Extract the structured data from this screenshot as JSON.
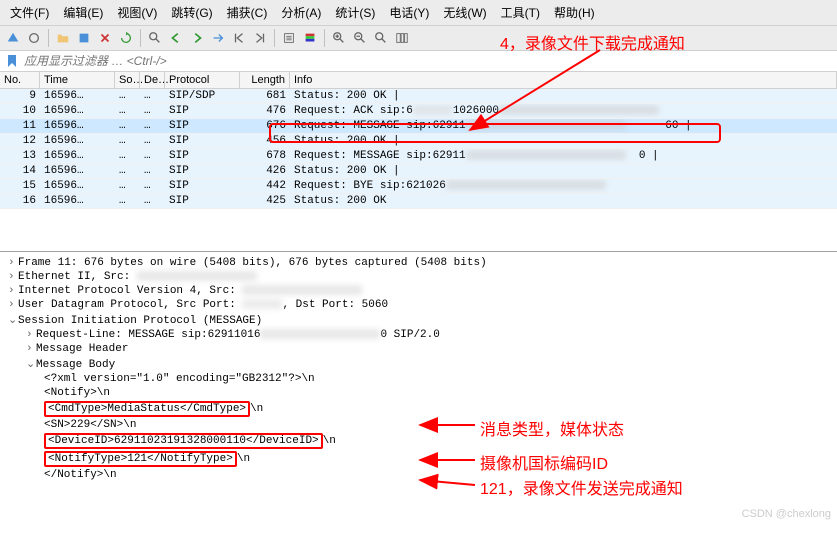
{
  "menu": {
    "file": "文件(F)",
    "edit": "编辑(E)",
    "view": "视图(V)",
    "go": "跳转(G)",
    "capture": "捕获(C)",
    "analyze": "分析(A)",
    "statistics": "统计(S)",
    "telephony": "电话(Y)",
    "wireless": "无线(W)",
    "tools": "工具(T)",
    "help": "帮助(H)"
  },
  "filter": {
    "placeholder": "应用显示过滤器 … <Ctrl-/>"
  },
  "headers": {
    "no": "No.",
    "time": "Time",
    "src": "So…",
    "dst": "De…",
    "proto": "Protocol",
    "len": "Length",
    "info": "Info"
  },
  "packets": [
    {
      "no": "9",
      "time": "16596…",
      "src": "…",
      "dst": "…",
      "proto": "SIP/SDP",
      "len": "681",
      "info": "Status: 200 OK  |"
    },
    {
      "no": "10",
      "time": "16596…",
      "src": "…",
      "dst": "…",
      "proto": "SIP",
      "len": "476",
      "info": "Request: ACK sip:6"
    },
    {
      "no": "11",
      "time": "16596…",
      "src": "…",
      "dst": "…",
      "proto": "SIP",
      "len": "676",
      "info": "Request: MESSAGE sip:62911",
      "selected": true,
      "tail": "60  |"
    },
    {
      "no": "12",
      "time": "16596…",
      "src": "…",
      "dst": "…",
      "proto": "SIP",
      "len": "456",
      "info": "Status: 200 OK  |"
    },
    {
      "no": "13",
      "time": "16596…",
      "src": "…",
      "dst": "…",
      "proto": "SIP",
      "len": "678",
      "info": "Request: MESSAGE sip:62911",
      "tail": "0  |"
    },
    {
      "no": "14",
      "time": "16596…",
      "src": "…",
      "dst": "…",
      "proto": "SIP",
      "len": "426",
      "info": "Status: 200 OK  |"
    },
    {
      "no": "15",
      "time": "16596…",
      "src": "…",
      "dst": "…",
      "proto": "SIP",
      "len": "442",
      "info": "Request: BYE sip:621026"
    },
    {
      "no": "16",
      "time": "16596…",
      "src": "…",
      "dst": "…",
      "proto": "SIP",
      "len": "425",
      "info": "Status: 200 OK"
    }
  ],
  "details": {
    "frame": "Frame 11: 676 bytes on wire (5408 bits), 676 bytes captured (5408 bits)",
    "eth": "Ethernet II, Src: ",
    "ip": "Internet Protocol Version 4, Src: ",
    "udp": "User Datagram Protocol, Src Port: ",
    "udp_tail": ", Dst Port: 5060",
    "sip": "Session Initiation Protocol (MESSAGE)",
    "reqline": "Request-Line: MESSAGE sip:62911016",
    "reqline_tail": "0 SIP/2.0",
    "msgheader": "Message Header",
    "msgbody": "Message Body",
    "xml1": "<?xml version=\"1.0\" encoding=\"GB2312\"?>\\n",
    "xml2": "<Notify>\\n",
    "xml3": "<CmdType>MediaStatus</CmdType>",
    "xml3_tail": "\\n",
    "xml4": "<SN>229</SN>\\n",
    "xml5": "<DeviceID>62911023191328000110</DeviceID>",
    "xml5_tail": "\\n",
    "xml6": "<NotifyType>121</NotifyType>",
    "xml6_tail": "\\n",
    "xml7": "</Notify>\\n"
  },
  "annotations": {
    "top": "4，录像文件下载完成通知",
    "a1": "消息类型，媒体状态",
    "a2": "摄像机国标编码ID",
    "a3": "121，录像文件发送完成通知"
  },
  "watermark": "CSDN @chexlong"
}
